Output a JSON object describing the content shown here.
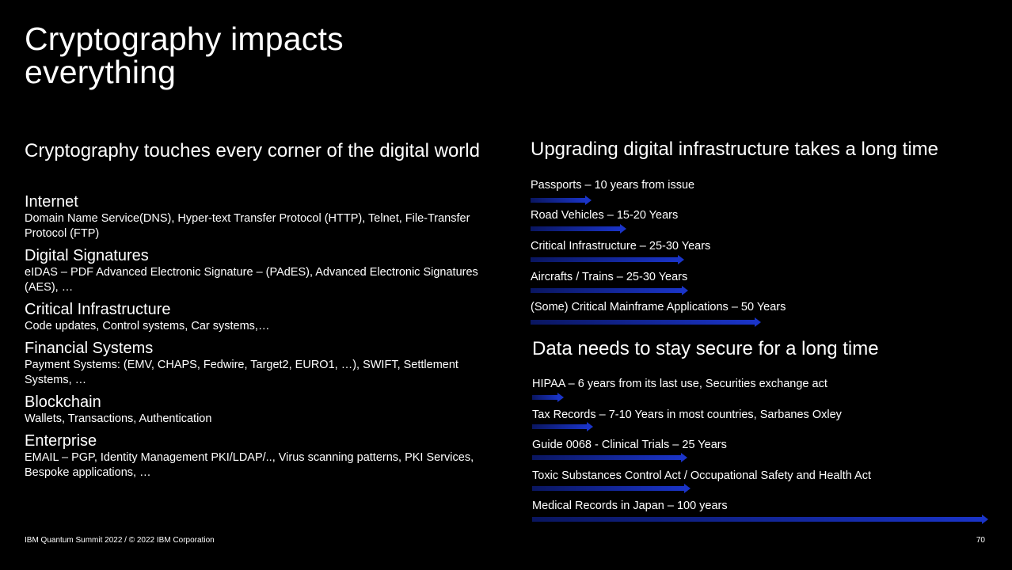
{
  "slide": {
    "title": "Cryptography impacts everything",
    "left": {
      "heading": "Cryptography touches every corner of the digital world",
      "categories": [
        {
          "title": "Internet",
          "description": "Domain Name Service(DNS), Hyper-text Transfer Protocol (HTTP), Telnet, File-Transfer Protocol (FTP)"
        },
        {
          "title": "Digital Signatures",
          "description": "eIDAS – PDF Advanced Electronic Signature – (PAdES), Advanced  Electronic Signatures  (AES), …"
        },
        {
          "title": "Critical Infrastructure",
          "description": "Code updates, Control systems, Car systems,…"
        },
        {
          "title": "Financial Systems",
          "description": "Payment Systems: (EMV, CHAPS, Fedwire, Target2, EURO1, …), SWIFT, Settlement Systems, …"
        },
        {
          "title": "Blockchain",
          "description": "Wallets, Transactions, Authentication"
        },
        {
          "title": "Enterprise",
          "description": "EMAIL – PGP, Identity Management PKI/LDAP/.., Virus scanning patterns, PKI Services, Bespoke applications, …"
        }
      ]
    },
    "upgrade": {
      "heading": "Upgrading digital infrastructure takes a long time",
      "items": [
        {
          "label": "Passports – 10 years from issue",
          "years": 10
        },
        {
          "label": "Road Vehicles – 15-20 Years",
          "years": 20
        },
        {
          "label": "Critical Infrastructure – 25-30 Years",
          "years": 30
        },
        {
          "label": "Aircrafts / Trains – 25-30 Years",
          "years": 30
        },
        {
          "label": "(Some) Critical Mainframe Applications – 50 Years",
          "years": 50
        }
      ]
    },
    "data": {
      "heading": "Data needs to stay secure for a long time",
      "items": [
        {
          "label": "HIPAA – 6 years from its last use, Securities exchange act",
          "years": 6
        },
        {
          "label": "Tax Records – 7-10 Years in most countries, Sarbanes Oxley",
          "years": 10
        },
        {
          "label": "Guide 0068 - Clinical Trials – 25 Years",
          "years": 25
        },
        {
          "label": "Toxic Substances Control Act / Occupational Safety and Health Act",
          "years": 30
        },
        {
          "label": "Medical Records in Japan – 100 years",
          "years": 100
        }
      ]
    },
    "footer": "IBM Quantum Summit 2022 / © 2022 IBM Corporation",
    "page_number": "70"
  },
  "colors": {
    "background": "#000000",
    "text": "#ffffff",
    "arrow_start": "#0a1660",
    "arrow_end": "#1a34c8"
  }
}
